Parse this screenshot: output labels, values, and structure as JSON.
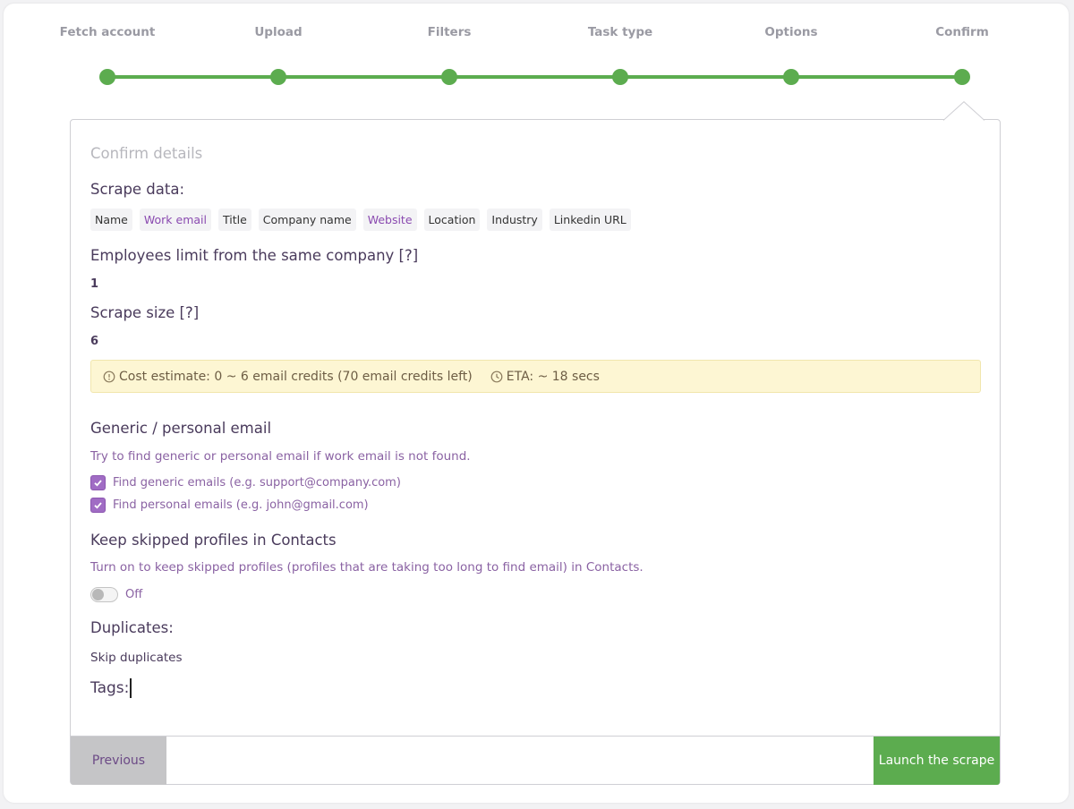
{
  "stepper": {
    "steps": [
      {
        "label": "Fetch account"
      },
      {
        "label": "Upload"
      },
      {
        "label": "Filters"
      },
      {
        "label": "Task type"
      },
      {
        "label": "Options"
      },
      {
        "label": "Confirm"
      }
    ],
    "active_step": "Confirm",
    "accent_color": "#5cac4f"
  },
  "panel": {
    "title": "Confirm details",
    "scrape_data": {
      "heading": "Scrape data:",
      "fields": [
        "Name",
        "Work email",
        "Title",
        "Company name",
        "Website",
        "Location",
        "Industry",
        "Linkedin URL"
      ]
    },
    "employees_limit": {
      "heading": "Employees limit from the same company [?]",
      "value": "1"
    },
    "scrape_size": {
      "heading": "Scrape size [?]",
      "value": "6"
    },
    "estimate": {
      "cost_text": "Cost estimate: 0 ~ 6 email credits (70 email credits left)",
      "eta_text": "ETA: ~ 18 secs",
      "cost_icon": "info-circle-icon",
      "eta_icon": "clock-icon"
    },
    "generic_personal": {
      "heading": "Generic / personal email",
      "description": "Try to find generic or personal email if work email is not found.",
      "options": [
        {
          "label": "Find generic emails (e.g. support@company.com)",
          "checked": true
        },
        {
          "label": "Find personal emails (e.g. john@gmail.com)",
          "checked": true
        }
      ]
    },
    "keep_skipped": {
      "heading": "Keep skipped profiles in Contacts",
      "description": "Turn on to keep skipped profiles (profiles that are taking too long to find email) in Contacts.",
      "toggle_state": false,
      "toggle_label": "Off"
    },
    "duplicates": {
      "heading": "Duplicates:",
      "value": "Skip duplicates"
    },
    "tags": {
      "heading": "Tags:"
    }
  },
  "footer": {
    "previous_label": "Previous",
    "launch_label": "Launch the scrape"
  }
}
